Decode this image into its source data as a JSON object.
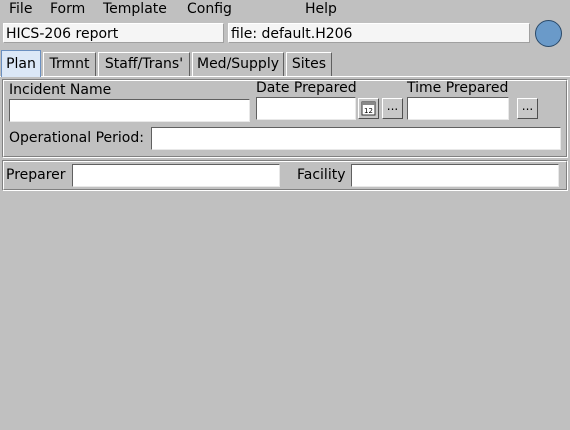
{
  "menu": {
    "file": "File",
    "form": "Form",
    "template": "Template",
    "config": "Config",
    "help": "Help"
  },
  "header": {
    "report_title": "HICS-206 report",
    "file_label": "file: default.H206"
  },
  "tabs": [
    {
      "label": "Plan",
      "active": true
    },
    {
      "label": "Trmnt",
      "active": false
    },
    {
      "label": "Staff/Trans'",
      "active": false
    },
    {
      "label": "Med/Supply",
      "active": false
    },
    {
      "label": "Sites",
      "active": false
    }
  ],
  "plan": {
    "incident_name_label": "Incident Name",
    "incident_name_value": "",
    "date_prepared_label": "Date Prepared",
    "date_prepared_value": "",
    "calendar_day": "12",
    "date_more_label": "...",
    "time_prepared_label": "Time Prepared",
    "time_prepared_value": "",
    "time_more_label": "...",
    "operational_period_label": "Operational Period:",
    "operational_period_value": ""
  },
  "footer": {
    "preparer_label": "Preparer",
    "preparer_value": "",
    "facility_label": "Facility",
    "facility_value": ""
  },
  "colors": {
    "background": "#c0c0c0",
    "status_indicator": "#6a9ac9",
    "active_tab": "#dce8f7"
  }
}
